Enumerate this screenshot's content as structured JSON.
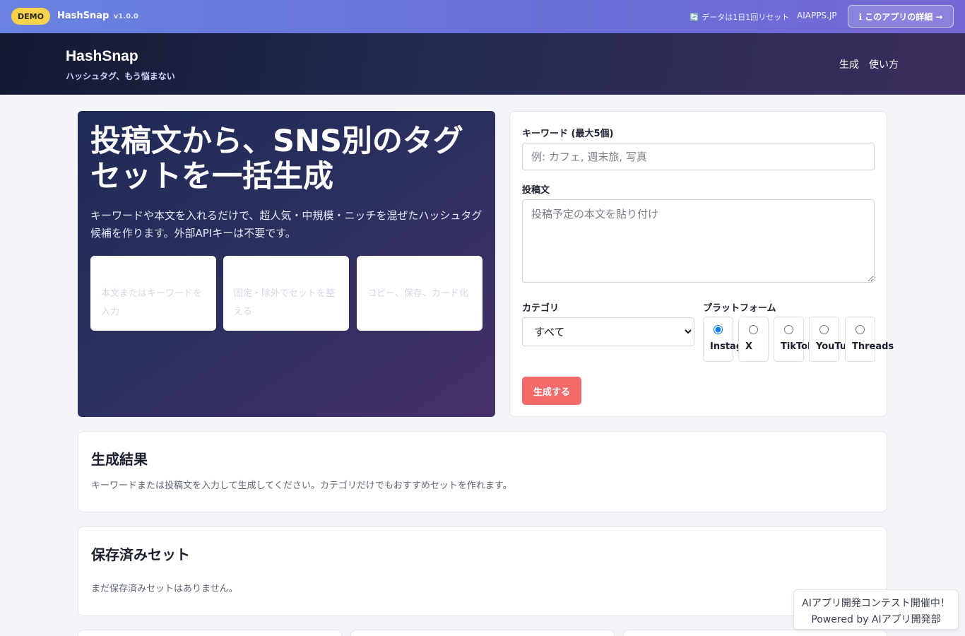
{
  "demo_bar": {
    "badge": "DEMO",
    "app_name": "HashSnap",
    "version": "v1.0.0",
    "reset_note": "🔄 データは1日1回リセット",
    "site_link": "AIAPPS.JP",
    "detail_button": "ℹ このアプリの詳細 →"
  },
  "header": {
    "title": "HashSnap",
    "subtitle": "ハッシュタグ、もう悩まない",
    "nav": [
      "生成",
      "使い方"
    ]
  },
  "hero": {
    "title": "投稿文から、SNS別のタグセットを一括生成",
    "description": "キーワードや本文を入れるだけで、超人気・中規模・ニッチを混ぜたハッシュタグ候補を作ります。外部APIキーは不要です。",
    "steps": [
      "本文またはキーワードを入力",
      "固定・除外でセットを整える",
      "コピー、保存、カード化"
    ]
  },
  "form": {
    "keyword_label": "キーワード (最大5個)",
    "keyword_placeholder": "例: カフェ, 週末旅, 写真",
    "post_label": "投稿文",
    "post_placeholder": "投稿予定の本文を貼り付け",
    "category_label": "カテゴリ",
    "category_selected": "すべて",
    "platform_label": "プラットフォーム",
    "platforms": [
      "Instagram",
      "X",
      "TikTok",
      "YouTube",
      "Threads"
    ],
    "selected_platform": "Instagram",
    "generate_button": "生成する"
  },
  "results": {
    "heading": "生成結果",
    "empty_message": "キーワードまたは投稿文を入力して生成してください。カテゴリだけでもおすすめセットを作れます。"
  },
  "saved": {
    "heading": "保存済みセット",
    "empty_message": "まだ保存済みセットはありません。"
  },
  "contest_banner": {
    "line1": "AIアプリ開発コンテスト開催中！",
    "line2": "Powered by AIアプリ開発部"
  },
  "colors": {
    "accent": "#f26a6a",
    "demo_badge": "#f6d34a",
    "demo_bar": "#6a76dc",
    "header_bg": "#1d2244"
  }
}
